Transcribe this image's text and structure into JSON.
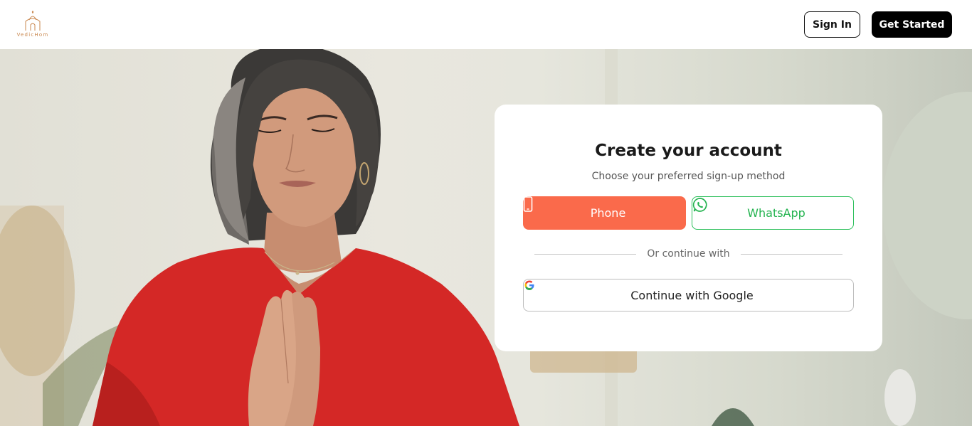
{
  "header": {
    "logo_text": "VedicHom",
    "signin_label": "Sign In",
    "get_started_label": "Get Started"
  },
  "signup": {
    "title": "Create your account",
    "subtitle": "Choose your preferred sign-up method",
    "phone_label": "Phone",
    "whatsapp_label": "WhatsApp",
    "divider_text": "Or continue with",
    "google_label": "Continue with Google"
  },
  "colors": {
    "accent": "#fa6a4b",
    "whatsapp": "#23b34f",
    "logo": "#c9874e",
    "dark_button": "#000000"
  },
  "icons": {
    "logo": "temple-icon",
    "phone": "smartphone-icon",
    "whatsapp": "whatsapp-icon",
    "google": "google-icon"
  }
}
